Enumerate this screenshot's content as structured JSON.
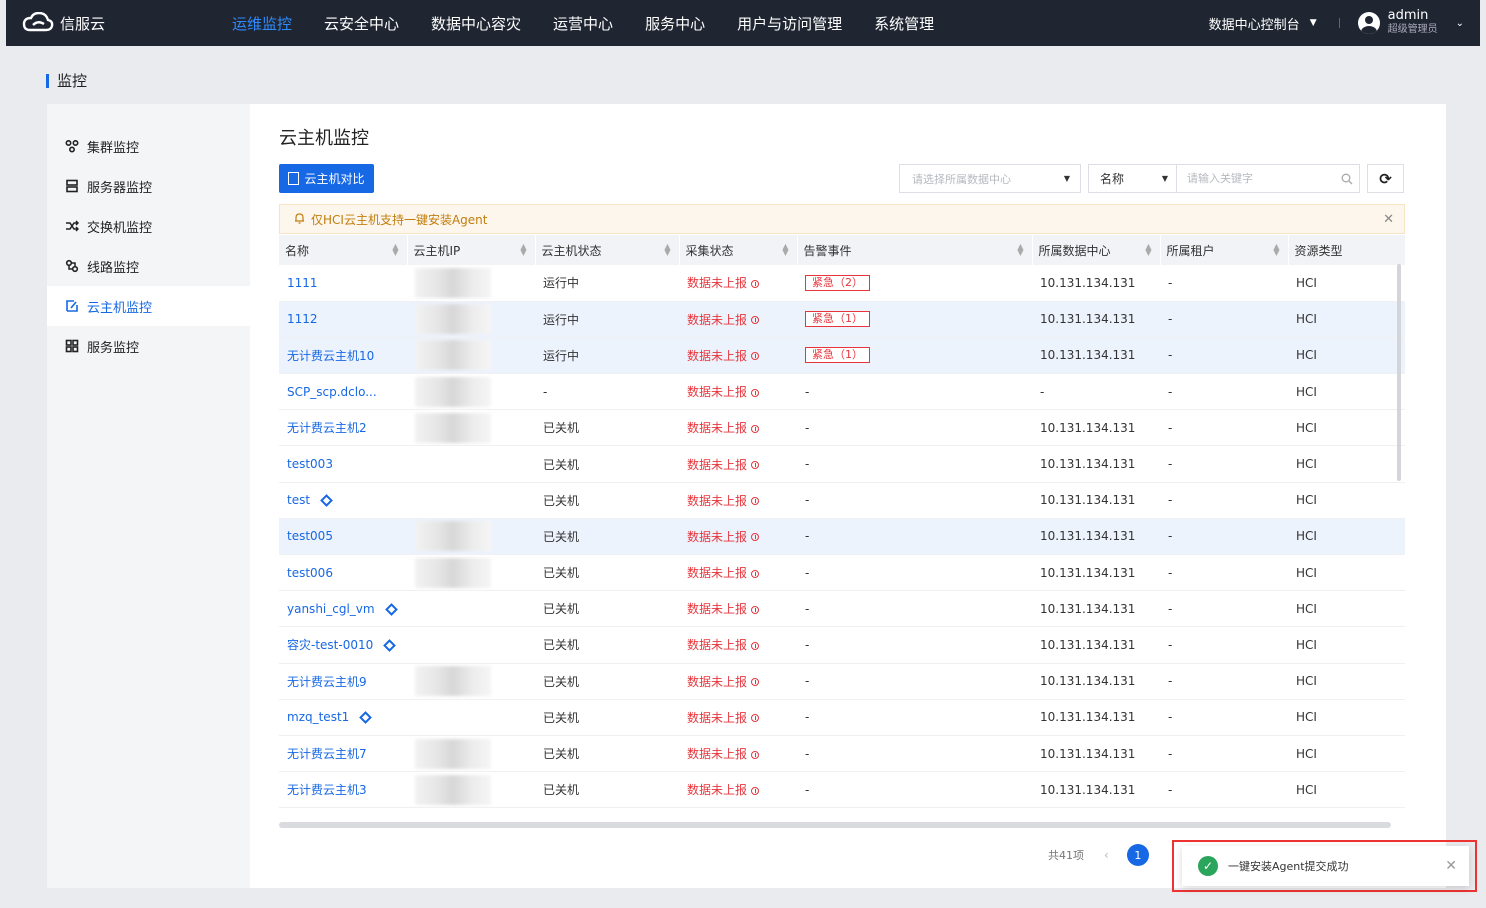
{
  "app": {
    "logo_text": "信服云",
    "nav": [
      "运维监控",
      "云安全中心",
      "数据中心容灾",
      "运营中心",
      "服务中心",
      "用户与访问管理",
      "系统管理"
    ],
    "console_label": "数据中心控制台",
    "user_name": "admin",
    "user_role": "超级管理员"
  },
  "page": {
    "title": "监控"
  },
  "sidebar": {
    "items": [
      {
        "label": "集群监控",
        "icon": "cluster-icon"
      },
      {
        "label": "服务器监控",
        "icon": "server-icon"
      },
      {
        "label": "交换机监控",
        "icon": "switch-icon"
      },
      {
        "label": "线路监控",
        "icon": "link-icon"
      },
      {
        "label": "云主机监控",
        "icon": "vm-icon",
        "active": true
      },
      {
        "label": "服务监控",
        "icon": "service-grid-icon"
      }
    ]
  },
  "main": {
    "title": "云主机监控",
    "compare_button": "云主机对比",
    "dc_select_placeholder": "请选择所属数据中心",
    "search_field": "名称",
    "search_placeholder": "请输入关键字",
    "alert_text": "仅HCI云主机支持一键安装Agent"
  },
  "table": {
    "columns": [
      "名称",
      "云主机IP",
      "云主机状态",
      "采集状态",
      "告警事件",
      "所属数据中心",
      "所属租户",
      "资源类型"
    ],
    "rows": [
      {
        "name": "1111",
        "state": "运行中",
        "collect": "数据未上报",
        "alarm": "紧急（2）",
        "dc": "10.131.134.131",
        "tenant": "-",
        "type": "HCI",
        "agent": false,
        "hl": false,
        "blur": true
      },
      {
        "name": "1112",
        "state": "运行中",
        "collect": "数据未上报",
        "alarm": "紧急（1）",
        "dc": "10.131.134.131",
        "tenant": "-",
        "type": "HCI",
        "agent": false,
        "hl": true,
        "blur": true
      },
      {
        "name": "无计费云主机10",
        "state": "运行中",
        "collect": "数据未上报",
        "alarm": "紧急（1）",
        "dc": "10.131.134.131",
        "tenant": "-",
        "type": "HCI",
        "agent": false,
        "hl": true,
        "blur": true
      },
      {
        "name": "SCP_scp.dclo...",
        "state": "-",
        "collect": "数据未上报",
        "alarm": "-",
        "dc": "-",
        "tenant": "-",
        "type": "HCI",
        "agent": false,
        "hl": false,
        "blur": true
      },
      {
        "name": "无计费云主机2",
        "state": "已关机",
        "collect": "数据未上报",
        "alarm": "-",
        "dc": "10.131.134.131",
        "tenant": "-",
        "type": "HCI",
        "agent": false,
        "hl": false,
        "blur": true
      },
      {
        "name": "test003",
        "state": "已关机",
        "collect": "数据未上报",
        "alarm": "-",
        "dc": "10.131.134.131",
        "tenant": "-",
        "type": "HCI",
        "agent": false,
        "hl": false,
        "blur": false
      },
      {
        "name": "test",
        "state": "已关机",
        "collect": "数据未上报",
        "alarm": "-",
        "dc": "10.131.134.131",
        "tenant": "-",
        "type": "HCI",
        "agent": true,
        "hl": false,
        "blur": false
      },
      {
        "name": "test005",
        "state": "已关机",
        "collect": "数据未上报",
        "alarm": "-",
        "dc": "10.131.134.131",
        "tenant": "-",
        "type": "HCI",
        "agent": false,
        "hl": true,
        "blur": true
      },
      {
        "name": "test006",
        "state": "已关机",
        "collect": "数据未上报",
        "alarm": "-",
        "dc": "10.131.134.131",
        "tenant": "-",
        "type": "HCI",
        "agent": false,
        "hl": false,
        "blur": true
      },
      {
        "name": "yanshi_cgl_vm",
        "state": "已关机",
        "collect": "数据未上报",
        "alarm": "-",
        "dc": "10.131.134.131",
        "tenant": "-",
        "type": "HCI",
        "agent": true,
        "hl": false,
        "blur": false
      },
      {
        "name": "容灾-test-0010",
        "state": "已关机",
        "collect": "数据未上报",
        "alarm": "-",
        "dc": "10.131.134.131",
        "tenant": "-",
        "type": "HCI",
        "agent": true,
        "hl": false,
        "blur": false
      },
      {
        "name": "无计费云主机9",
        "state": "已关机",
        "collect": "数据未上报",
        "alarm": "-",
        "dc": "10.131.134.131",
        "tenant": "-",
        "type": "HCI",
        "agent": false,
        "hl": false,
        "blur": true
      },
      {
        "name": "mzq_test1",
        "state": "已关机",
        "collect": "数据未上报",
        "alarm": "-",
        "dc": "10.131.134.131",
        "tenant": "-",
        "type": "HCI",
        "agent": true,
        "hl": false,
        "blur": false
      },
      {
        "name": "无计费云主机7",
        "state": "已关机",
        "collect": "数据未上报",
        "alarm": "-",
        "dc": "10.131.134.131",
        "tenant": "-",
        "type": "HCI",
        "agent": false,
        "hl": false,
        "blur": true
      },
      {
        "name": "无计费云主机3",
        "state": "已关机",
        "collect": "数据未上报",
        "alarm": "-",
        "dc": "10.131.134.131",
        "tenant": "-",
        "type": "HCI",
        "agent": false,
        "hl": false,
        "blur": true
      }
    ]
  },
  "pagination": {
    "total": "共41项",
    "current": "1"
  },
  "toast": {
    "message": "一键安装Agent提交成功"
  },
  "colors": {
    "accent": "#1768e4",
    "topbar": "#1f2632",
    "danger": "#e8353c",
    "success": "#2aa55b"
  }
}
